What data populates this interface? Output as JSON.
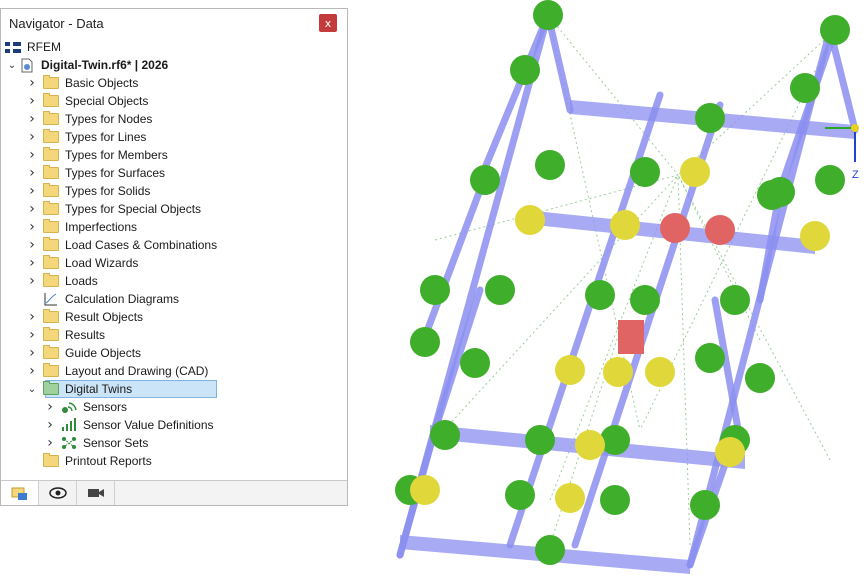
{
  "navigator": {
    "title": "Navigator - Data",
    "close_glyph": "x",
    "root": "RFEM",
    "model": "Digital-Twin.rf6* | 2026",
    "items": [
      {
        "label": "Basic Objects",
        "icon": "folder-icon"
      },
      {
        "label": "Special Objects",
        "icon": "folder-icon"
      },
      {
        "label": "Types for Nodes",
        "icon": "folder-icon"
      },
      {
        "label": "Types for Lines",
        "icon": "folder-icon"
      },
      {
        "label": "Types for Members",
        "icon": "folder-icon"
      },
      {
        "label": "Types for Surfaces",
        "icon": "folder-icon"
      },
      {
        "label": "Types for Solids",
        "icon": "folder-icon"
      },
      {
        "label": "Types for Special Objects",
        "icon": "folder-icon"
      },
      {
        "label": "Imperfections",
        "icon": "folder-icon"
      },
      {
        "label": "Load Cases & Combinations",
        "icon": "folder-icon"
      },
      {
        "label": "Load Wizards",
        "icon": "folder-icon"
      },
      {
        "label": "Loads",
        "icon": "folder-icon"
      },
      {
        "label": "Calculation Diagrams",
        "icon": "chart-icon"
      },
      {
        "label": "Result Objects",
        "icon": "folder-icon"
      },
      {
        "label": "Results",
        "icon": "folder-icon"
      },
      {
        "label": "Guide Objects",
        "icon": "folder-icon"
      },
      {
        "label": "Layout and Drawing (CAD)",
        "icon": "folder-icon"
      },
      {
        "label": "Digital Twins",
        "icon": "folder-icon"
      },
      {
        "label": "Sensors",
        "icon": "sensor-icon"
      },
      {
        "label": "Sensor Value Definitions",
        "icon": "signal-bars-icon"
      },
      {
        "label": "Sensor Sets",
        "icon": "sensor-set-icon"
      },
      {
        "label": "Printout Reports",
        "icon": "folder-icon"
      }
    ],
    "tabs": [
      "data-tab-icon",
      "display-eye-icon",
      "views-camera-icon"
    ]
  },
  "model_view": {
    "axis_label": "Z",
    "colors": {
      "member": "#8b8ff0",
      "sensor_green": "#3fae2b",
      "sensor_yellow": "#e0d83a",
      "sensor_red": "#e06464"
    }
  }
}
